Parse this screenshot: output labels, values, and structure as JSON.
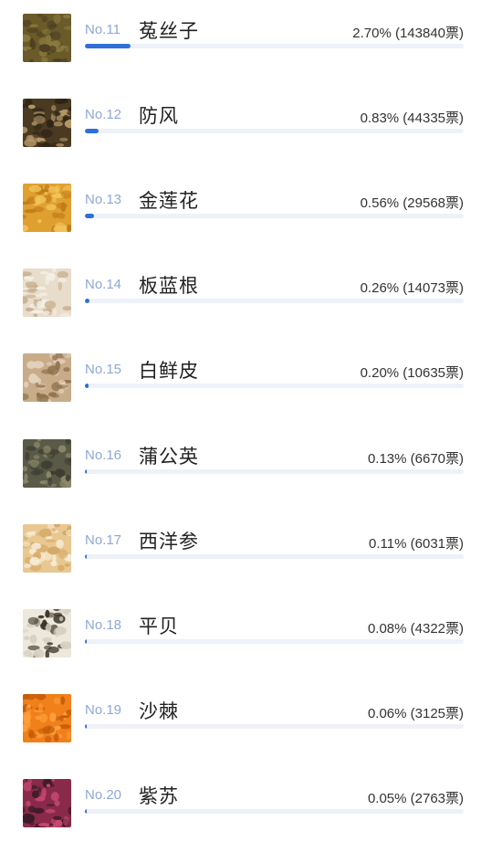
{
  "accent_color": "#2f6fd8",
  "track_color": "#eef1f8",
  "rank_color": "#8fa8d6",
  "items": [
    {
      "rank": "No.11",
      "name": "菟丝子",
      "stat": "2.70% (143840票)",
      "percent": 2.7,
      "image": "seed-grain-image",
      "palette": [
        "#6b5a2a",
        "#8a7a3e",
        "#4d4020"
      ]
    },
    {
      "rank": "No.12",
      "name": "防风",
      "stat": "0.83% (44335票)",
      "percent": 0.83,
      "image": "root-slices-image",
      "palette": [
        "#4a3a22",
        "#b49868",
        "#2e2416"
      ]
    },
    {
      "rank": "No.13",
      "name": "金莲花",
      "stat": "0.56% (29568票)",
      "percent": 0.56,
      "image": "dried-flower-image",
      "palette": [
        "#e0a030",
        "#f2c45a",
        "#c07a18"
      ]
    },
    {
      "rank": "No.14",
      "name": "板蓝根",
      "stat": "0.26% (14073票)",
      "percent": 0.26,
      "image": "root-pieces-image",
      "palette": [
        "#e8dccb",
        "#c8b090",
        "#f4efe6"
      ]
    },
    {
      "rank": "No.15",
      "name": "白鲜皮",
      "stat": "0.20% (10635票)",
      "percent": 0.2,
      "image": "bark-rolls-image",
      "palette": [
        "#c8ab88",
        "#e2d2bc",
        "#8f7350"
      ]
    },
    {
      "rank": "No.16",
      "name": "蒲公英",
      "stat": "0.13% (6670票)",
      "percent": 0.13,
      "image": "dried-herb-image",
      "palette": [
        "#5a5a48",
        "#8d8a6a",
        "#3c3c30"
      ]
    },
    {
      "rank": "No.17",
      "name": "西洋参",
      "stat": "0.11% (6031票)",
      "percent": 0.11,
      "image": "ginseng-root-image",
      "palette": [
        "#e8c890",
        "#d4a866",
        "#f7ecd6"
      ]
    },
    {
      "rank": "No.18",
      "name": "平贝",
      "stat": "0.08% (4322票)",
      "percent": 0.08,
      "image": "bulb-pieces-image",
      "palette": [
        "#ece8dc",
        "#d6d0c0",
        "#3a3428"
      ]
    },
    {
      "rank": "No.19",
      "name": "沙棘",
      "stat": "0.06% (3125票)",
      "percent": 0.06,
      "image": "berries-image",
      "palette": [
        "#f0801a",
        "#ff9f3a",
        "#c25a08"
      ]
    },
    {
      "rank": "No.20",
      "name": "紫苏",
      "stat": "0.05% (2763票)",
      "percent": 0.05,
      "image": "purple-leaf-image",
      "palette": [
        "#8a2a4a",
        "#c94a74",
        "#3a1a28"
      ]
    }
  ]
}
